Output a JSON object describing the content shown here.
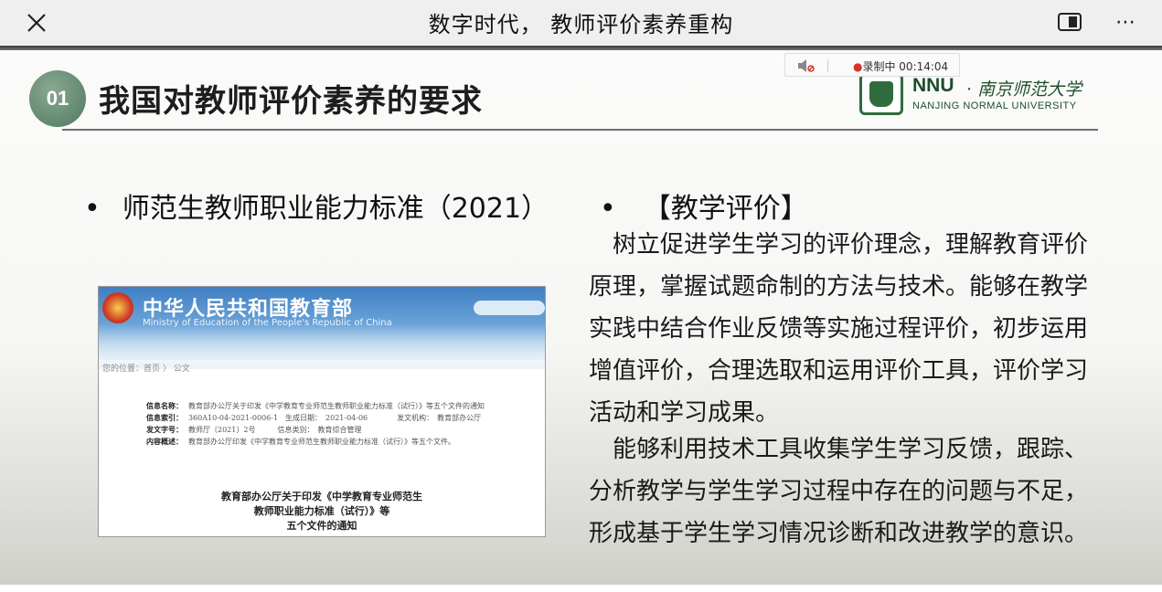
{
  "topbar": {
    "title": "数字时代， 教师评价素养重构",
    "close_icon": "close-icon",
    "more_label": "⋯"
  },
  "slide": {
    "section_number": "01",
    "section_title": "我国对教师评价素养的要求",
    "logo": {
      "nnu": "NNU",
      "cn": "· 南京师范大学",
      "en": "NANJING NORMAL UNIVERSITY"
    },
    "recording": {
      "label": "录制中 00:14:04"
    },
    "left_bullet": "师范生教师职业能力标准（2021）",
    "right_bullet": "【教学评价】",
    "paragraph1": "　树立促进学生学习的评价理念，理解教育评价原理，掌握试题命制的方法与技术。能够在教学实践中结合作业反馈等实施过程评价，初步运用增值评价，合理选取和运用评价工具，评价学习活动和学习成果。",
    "paragraph2": "　能够利用技术工具收集学生学习反馈，跟踪、分析教学与学生学习过程中存在的问题与不足，形成基于学生学习情况诊断和改进教学的意识。",
    "doc": {
      "header_cn": "中华人民共和国教育部",
      "header_en": "Ministry of Education of the People's Republic of China",
      "breadcrumb": "您的位置：首页 〉 公文",
      "meta": [
        {
          "k": "信息名称：",
          "v": "教育部办公厅关于印发《中学教育专业师范生教师职业能力标准（试行）》等五个文件的通知"
        },
        {
          "k": "信息索引：",
          "v": "360A10-04-2021-0006-1　生成日期：　2021-04-06　　　　发文机构：　教育部办公厅"
        },
        {
          "k": "发文字号：",
          "v": "教师厅〔2021〕2号　　　信息类别：　教育综合管理"
        },
        {
          "k": "内容概述：",
          "v": "教育部办公厅印发《中学教育专业师范生教师职业能力标准（试行）》等五个文件。"
        }
      ],
      "title_line1": "教育部办公厅关于印发《中学教育专业师范生",
      "title_line2": "教师职业能力标准（试行）》等",
      "title_line3": "五个文件的通知"
    }
  }
}
